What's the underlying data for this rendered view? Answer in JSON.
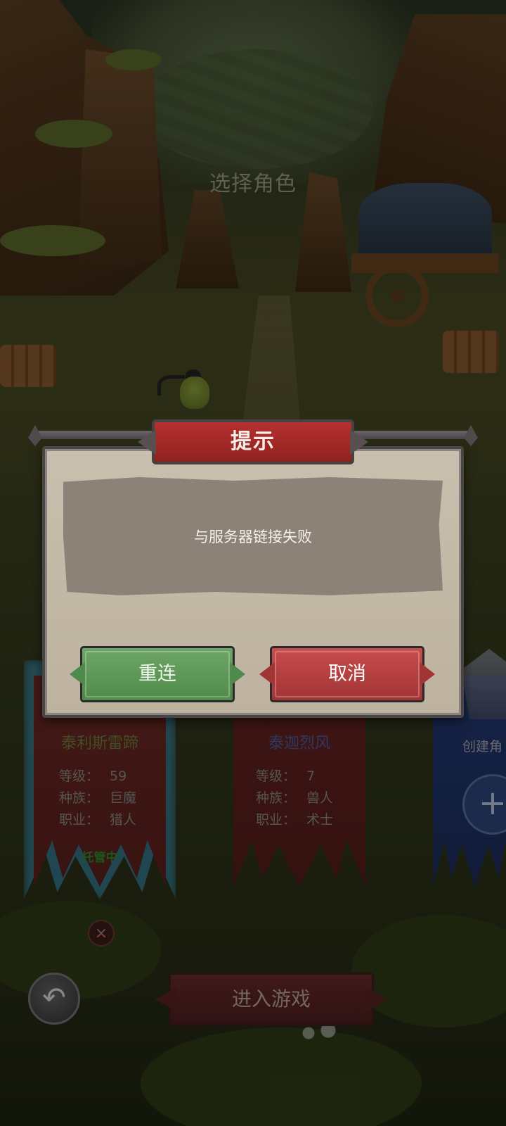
{
  "screen": {
    "title": "选择角色"
  },
  "characters": [
    {
      "name": "泰利斯雷蹄",
      "level_label": "等级：",
      "level": "59",
      "race_label": "种族：",
      "race": "巨魔",
      "class_label": "职业：",
      "class": "猎人",
      "status": "托管中",
      "selected": true
    },
    {
      "name": "泰迦烈风",
      "level_label": "等级：",
      "level": "7",
      "race_label": "种族：",
      "race": "兽人",
      "class_label": "职业：",
      "class": "术士",
      "selected": false
    }
  ],
  "create_slot": {
    "label": "创建角",
    "plus": "+"
  },
  "controls": {
    "delete_icon": "×",
    "back_icon": "↶",
    "enter_game_label": "进入游戏"
  },
  "dialog": {
    "title": "提示",
    "message": "与服务器链接失败",
    "reconnect_label": "重连",
    "cancel_label": "取消"
  },
  "colors": {
    "reconnect": "#5a9654",
    "cancel": "#b43c3c",
    "dialog_header": "#a52a28",
    "selected_glow": "#3caadc"
  },
  "icons": {
    "back": "back-arrow-icon",
    "delete": "close-icon",
    "create": "plus-icon"
  }
}
